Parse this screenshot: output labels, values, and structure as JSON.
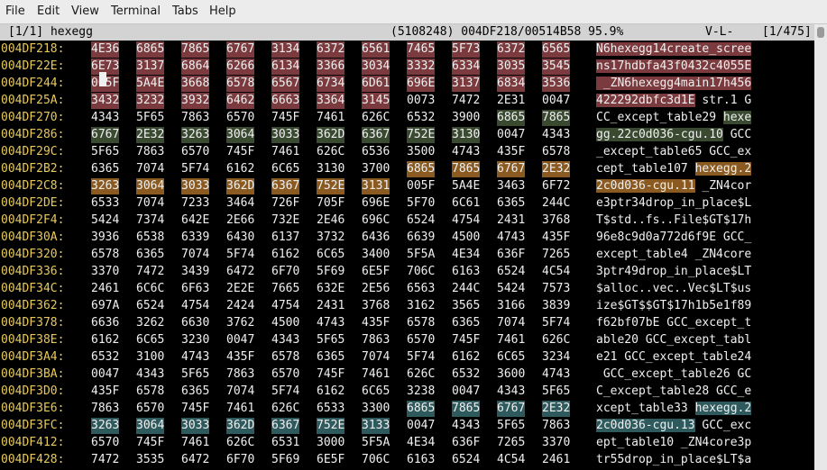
{
  "menu": [
    "File",
    "Edit",
    "View",
    "Terminal",
    "Tabs",
    "Help"
  ],
  "status": {
    "left": "[1/1] hexegg",
    "position": "(5108248) 004DF218/00514B58 95.9%",
    "mode": "V-L-",
    "page": "[1/475]"
  },
  "scroll_fraction": 0.959,
  "colors": {
    "address": "#e8c95a",
    "text": "#f0f0f0",
    "highlight_pink": "#7a3a3e",
    "highlight_green": "#394a30",
    "highlight_orange": "#8a5a20",
    "highlight_teal": "#2e5a5e",
    "status_bg": "#d3d3d3"
  },
  "rows": [
    {
      "addr": "004DF218:",
      "hex": [
        "4E36",
        "6865",
        "7865",
        "6767",
        "3134",
        "6372",
        "6561",
        "7465",
        "5F73",
        "6372",
        "6565"
      ],
      "hl": [
        "pink",
        "pink",
        "pink",
        "pink",
        "pink",
        "pink",
        "pink",
        "pink",
        "pink",
        "pink",
        "pink"
      ],
      "ascii": [
        [
          "N6hexegg14create_scree",
          "pink"
        ]
      ]
    },
    {
      "addr": "004DF22E:",
      "hex": [
        "6E73",
        "3137",
        "6864",
        "6266",
        "6134",
        "3366",
        "3034",
        "3332",
        "6334",
        "3035",
        "3545"
      ],
      "hl": [
        "pink",
        "pink",
        "pink",
        "pink",
        "pink",
        "pink",
        "pink",
        "pink",
        "pink",
        "pink",
        "pink"
      ],
      "ascii": [
        [
          "ns17hdbfa43f0432c4055E",
          "pink"
        ]
      ]
    },
    {
      "addr": "004DF244:",
      "hex": [
        "005F",
        "5A4E",
        "3668",
        "6578",
        "6567",
        "6734",
        "6D61",
        "696E",
        "3137",
        "6834",
        "3536"
      ],
      "hl": [
        "pink",
        "pink",
        "pink",
        "pink",
        "pink",
        "pink",
        "pink",
        "pink",
        "pink",
        "pink",
        "pink"
      ],
      "ascii": [
        [
          " _ZN6hexegg4main17h456",
          "pink"
        ]
      ]
    },
    {
      "addr": "004DF25A:",
      "hex": [
        "3432",
        "3232",
        "3932",
        "6462",
        "6663",
        "3364",
        "3145",
        "0073",
        "7472",
        "2E31",
        "0047"
      ],
      "hl": [
        "pink",
        "pink",
        "pink",
        "pink",
        "pink",
        "pink",
        "pink",
        "",
        "",
        "",
        ""
      ],
      "ascii": [
        [
          "422292dbfc3d1E",
          "pink"
        ],
        [
          " str.1 G",
          ""
        ]
      ]
    },
    {
      "addr": "004DF270:",
      "hex": [
        "4343",
        "5F65",
        "7863",
        "6570",
        "745F",
        "7461",
        "626C",
        "6532",
        "3900",
        "6865",
        "7865"
      ],
      "hl": [
        "",
        "",
        "",
        "",
        "",
        "",
        "",
        "",
        "",
        "green",
        "green"
      ],
      "ascii": [
        [
          "CC_except_table29 ",
          ""
        ],
        [
          "hexe",
          "green"
        ]
      ]
    },
    {
      "addr": "004DF286:",
      "hex": [
        "6767",
        "2E32",
        "3263",
        "3064",
        "3033",
        "362D",
        "6367",
        "752E",
        "3130",
        "0047",
        "4343"
      ],
      "hl": [
        "green",
        "green",
        "green",
        "green",
        "green",
        "green",
        "green",
        "green",
        "green",
        "",
        ""
      ],
      "ascii": [
        [
          "gg.22c0d036-cgu.10",
          "green"
        ],
        [
          " GCC",
          ""
        ]
      ]
    },
    {
      "addr": "004DF29C:",
      "hex": [
        "5F65",
        "7863",
        "6570",
        "745F",
        "7461",
        "626C",
        "6536",
        "3500",
        "4743",
        "435F",
        "6578"
      ],
      "hl": [
        "",
        "",
        "",
        "",
        "",
        "",
        "",
        "",
        "",
        "",
        ""
      ],
      "ascii": [
        [
          "_except_table65 GCC_ex",
          ""
        ]
      ]
    },
    {
      "addr": "004DF2B2:",
      "hex": [
        "6365",
        "7074",
        "5F74",
        "6162",
        "6C65",
        "3130",
        "3700",
        "6865",
        "7865",
        "6767",
        "2E32"
      ],
      "hl": [
        "",
        "",
        "",
        "",
        "",
        "",
        "",
        "orange",
        "orange",
        "orange",
        "orange"
      ],
      "ascii": [
        [
          "cept_table107 ",
          ""
        ],
        [
          "hexegg.2",
          "orange"
        ]
      ]
    },
    {
      "addr": "004DF2C8:",
      "hex": [
        "3263",
        "3064",
        "3033",
        "362D",
        "6367",
        "752E",
        "3131",
        "005F",
        "5A4E",
        "3463",
        "6F72"
      ],
      "hl": [
        "orange",
        "orange",
        "orange",
        "orange",
        "orange",
        "orange",
        "orange",
        "",
        "",
        "",
        ""
      ],
      "ascii": [
        [
          "2c0d036-cgu.11",
          "orange"
        ],
        [
          " _ZN4cor",
          ""
        ]
      ]
    },
    {
      "addr": "004DF2DE:",
      "hex": [
        "6533",
        "7074",
        "7233",
        "3464",
        "726F",
        "705F",
        "696E",
        "5F70",
        "6C61",
        "6365",
        "244C"
      ],
      "hl": [
        "",
        "",
        "",
        "",
        "",
        "",
        "",
        "",
        "",
        "",
        ""
      ],
      "ascii": [
        [
          "e3ptr34drop_in_place$L",
          ""
        ]
      ]
    },
    {
      "addr": "004DF2F4:",
      "hex": [
        "5424",
        "7374",
        "642E",
        "2E66",
        "732E",
        "2E46",
        "696C",
        "6524",
        "4754",
        "2431",
        "3768"
      ],
      "hl": [
        "",
        "",
        "",
        "",
        "",
        "",
        "",
        "",
        "",
        "",
        ""
      ],
      "ascii": [
        [
          "T$std..fs..File$GT$17h",
          ""
        ]
      ]
    },
    {
      "addr": "004DF30A:",
      "hex": [
        "3936",
        "6538",
        "6339",
        "6430",
        "6137",
        "3732",
        "6436",
        "6639",
        "4500",
        "4743",
        "435F"
      ],
      "hl": [
        "",
        "",
        "",
        "",
        "",
        "",
        "",
        "",
        "",
        "",
        ""
      ],
      "ascii": [
        [
          "96e8c9d0a772d6f9E GCC_",
          ""
        ]
      ]
    },
    {
      "addr": "004DF320:",
      "hex": [
        "6578",
        "6365",
        "7074",
        "5F74",
        "6162",
        "6C65",
        "3400",
        "5F5A",
        "4E34",
        "636F",
        "7265"
      ],
      "hl": [
        "",
        "",
        "",
        "",
        "",
        "",
        "",
        "",
        "",
        "",
        ""
      ],
      "ascii": [
        [
          "except_table4 _ZN4core",
          ""
        ]
      ]
    },
    {
      "addr": "004DF336:",
      "hex": [
        "3370",
        "7472",
        "3439",
        "6472",
        "6F70",
        "5F69",
        "6E5F",
        "706C",
        "6163",
        "6524",
        "4C54"
      ],
      "hl": [
        "",
        "",
        "",
        "",
        "",
        "",
        "",
        "",
        "",
        "",
        ""
      ],
      "ascii": [
        [
          "3ptr49drop_in_place$LT",
          ""
        ]
      ]
    },
    {
      "addr": "004DF34C:",
      "hex": [
        "2461",
        "6C6C",
        "6F63",
        "2E2E",
        "7665",
        "632E",
        "2E56",
        "6563",
        "244C",
        "5424",
        "7573"
      ],
      "hl": [
        "",
        "",
        "",
        "",
        "",
        "",
        "",
        "",
        "",
        "",
        ""
      ],
      "ascii": [
        [
          "$alloc..vec..Vec$LT$us",
          ""
        ]
      ]
    },
    {
      "addr": "004DF362:",
      "hex": [
        "697A",
        "6524",
        "4754",
        "2424",
        "4754",
        "2431",
        "3768",
        "3162",
        "3565",
        "3166",
        "3839"
      ],
      "hl": [
        "",
        "",
        "",
        "",
        "",
        "",
        "",
        "",
        "",
        "",
        ""
      ],
      "ascii": [
        [
          "ize$GT$$GT$17h1b5e1f89",
          ""
        ]
      ]
    },
    {
      "addr": "004DF378:",
      "hex": [
        "6636",
        "3262",
        "6630",
        "3762",
        "4500",
        "4743",
        "435F",
        "6578",
        "6365",
        "7074",
        "5F74"
      ],
      "hl": [
        "",
        "",
        "",
        "",
        "",
        "",
        "",
        "",
        "",
        "",
        ""
      ],
      "ascii": [
        [
          "f62bf07bE GCC_except_t",
          ""
        ]
      ]
    },
    {
      "addr": "004DF38E:",
      "hex": [
        "6162",
        "6C65",
        "3230",
        "0047",
        "4343",
        "5F65",
        "7863",
        "6570",
        "745F",
        "7461",
        "626C"
      ],
      "hl": [
        "",
        "",
        "",
        "",
        "",
        "",
        "",
        "",
        "",
        "",
        ""
      ],
      "ascii": [
        [
          "able20 GCC_except_tabl",
          ""
        ]
      ]
    },
    {
      "addr": "004DF3A4:",
      "hex": [
        "6532",
        "3100",
        "4743",
        "435F",
        "6578",
        "6365",
        "7074",
        "5F74",
        "6162",
        "6C65",
        "3234"
      ],
      "hl": [
        "",
        "",
        "",
        "",
        "",
        "",
        "",
        "",
        "",
        "",
        ""
      ],
      "ascii": [
        [
          "e21 GCC_except_table24",
          ""
        ]
      ]
    },
    {
      "addr": "004DF3BA:",
      "hex": [
        "0047",
        "4343",
        "5F65",
        "7863",
        "6570",
        "745F",
        "7461",
        "626C",
        "6532",
        "3600",
        "4743"
      ],
      "hl": [
        "",
        "",
        "",
        "",
        "",
        "",
        "",
        "",
        "",
        "",
        ""
      ],
      "ascii": [
        [
          " GCC_except_table26 GC",
          ""
        ]
      ]
    },
    {
      "addr": "004DF3D0:",
      "hex": [
        "435F",
        "6578",
        "6365",
        "7074",
        "5F74",
        "6162",
        "6C65",
        "3238",
        "0047",
        "4343",
        "5F65"
      ],
      "hl": [
        "",
        "",
        "",
        "",
        "",
        "",
        "",
        "",
        "",
        "",
        ""
      ],
      "ascii": [
        [
          "C_except_table28 GCC_e",
          ""
        ]
      ]
    },
    {
      "addr": "004DF3E6:",
      "hex": [
        "7863",
        "6570",
        "745F",
        "7461",
        "626C",
        "6533",
        "3300",
        "6865",
        "7865",
        "6767",
        "2E32"
      ],
      "hl": [
        "",
        "",
        "",
        "",
        "",
        "",
        "",
        "teal",
        "teal",
        "teal",
        "teal"
      ],
      "ascii": [
        [
          "xcept_table33 ",
          ""
        ],
        [
          "hexegg.2",
          "teal"
        ]
      ]
    },
    {
      "addr": "004DF3FC:",
      "hex": [
        "3263",
        "3064",
        "3033",
        "362D",
        "6367",
        "752E",
        "3133",
        "0047",
        "4343",
        "5F65",
        "7863"
      ],
      "hl": [
        "teal",
        "teal",
        "teal",
        "teal",
        "teal",
        "teal",
        "teal",
        "",
        "",
        "",
        ""
      ],
      "ascii": [
        [
          "2c0d036-cgu.13",
          "teal"
        ],
        [
          " GCC_exc",
          ""
        ]
      ]
    },
    {
      "addr": "004DF412:",
      "hex": [
        "6570",
        "745F",
        "7461",
        "626C",
        "6531",
        "3000",
        "5F5A",
        "4E34",
        "636F",
        "7265",
        "3370"
      ],
      "hl": [
        "",
        "",
        "",
        "",
        "",
        "",
        "",
        "",
        "",
        "",
        ""
      ],
      "ascii": [
        [
          "ept_table10 _ZN4core3p",
          ""
        ]
      ]
    },
    {
      "addr": "004DF428:",
      "hex": [
        "7472",
        "3535",
        "6472",
        "6F70",
        "5F69",
        "6E5F",
        "706C",
        "6163",
        "6524",
        "4C54",
        "2461"
      ],
      "hl": [
        "",
        "",
        "",
        "",
        "",
        "",
        "",
        "",
        "",
        "",
        ""
      ],
      "ascii": [
        [
          "tr55drop_in_place$LT$a",
          ""
        ]
      ]
    }
  ]
}
